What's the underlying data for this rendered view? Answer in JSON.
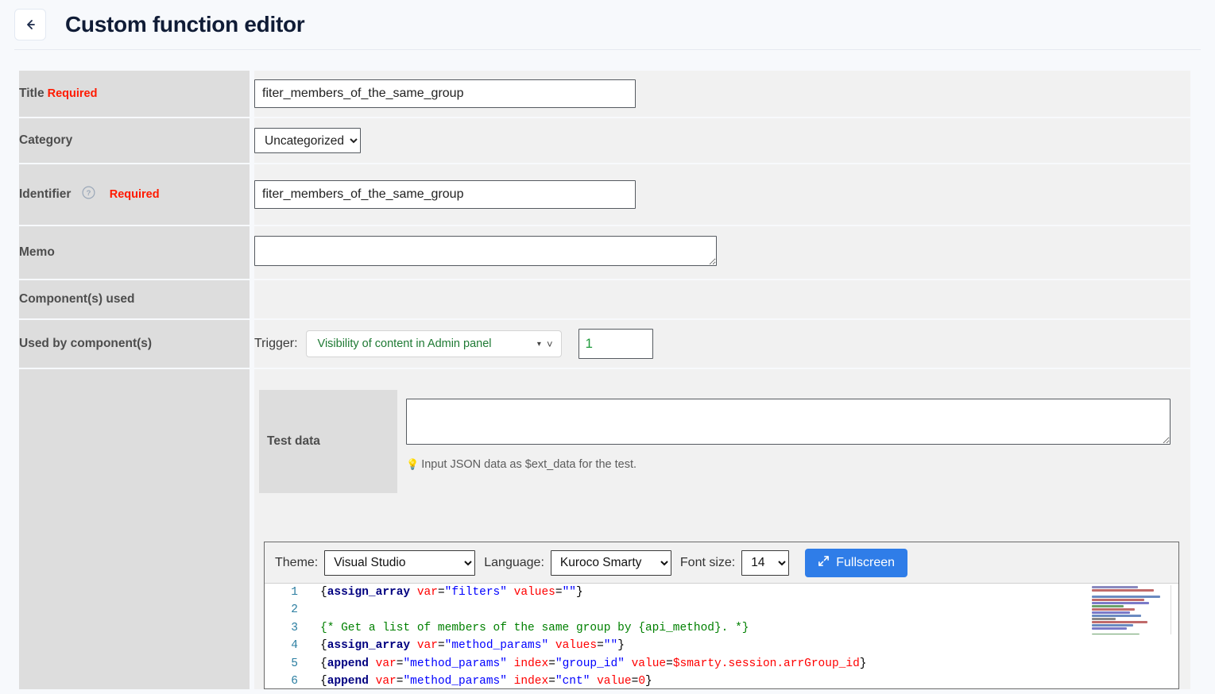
{
  "header": {
    "back_icon": "arrow-left-icon",
    "title": "Custom function editor"
  },
  "form": {
    "rows": [
      {
        "label": "Title",
        "required": "Required"
      },
      {
        "label": "Category"
      },
      {
        "label": "Identifier",
        "required": "Required",
        "help_icon": "question-circle-icon"
      },
      {
        "label": "Memo"
      },
      {
        "label": "Component(s) used"
      },
      {
        "label": "Used by component(s)"
      }
    ],
    "title_value": "fiter_members_of_the_same_group",
    "title_placeholder": "",
    "category_value": "Uncategorized",
    "category_options": [
      "Uncategorized"
    ],
    "identifier_value": "fiter_members_of_the_same_group",
    "identifier_placeholder": "",
    "memo_value": "",
    "memo_placeholder": ""
  },
  "trigger": {
    "label": "Trigger:",
    "selected": "Visibility of content in Admin panel",
    "options": [
      "Visibility of content in Admin panel"
    ],
    "caret_icon": "caret-down-icon",
    "chevron_icon": "chevron-down-icon",
    "number_value": "1"
  },
  "test_data": {
    "label": "Test data",
    "value": "",
    "placeholder": "",
    "hint_icon": "lightbulb-icon",
    "hint": "Input JSON data as $ext_data for the test."
  },
  "editor": {
    "theme_label": "Theme:",
    "theme_value": "Visual Studio",
    "theme_options": [
      "Visual Studio"
    ],
    "language_label": "Language:",
    "language_value": "Kuroco Smarty",
    "language_options": [
      "Kuroco Smarty"
    ],
    "fontsize_label": "Font size:",
    "fontsize_value": "14",
    "fontsize_options": [
      "14"
    ],
    "fullscreen_label": "Fullscreen",
    "fullscreen_icon": "expand-arrows-icon",
    "minimap_icon": "minimap",
    "lines": [
      {
        "n": "1",
        "tokens": [
          {
            "t": "{",
            "c": ""
          },
          {
            "t": "assign_array",
            "c": "k"
          },
          {
            "t": " ",
            "c": ""
          },
          {
            "t": "var",
            "c": "at"
          },
          {
            "t": "=",
            "c": ""
          },
          {
            "t": "\"filters\"",
            "c": "s"
          },
          {
            "t": " ",
            "c": ""
          },
          {
            "t": "values",
            "c": "at"
          },
          {
            "t": "=",
            "c": ""
          },
          {
            "t": "\"\"",
            "c": "s"
          },
          {
            "t": "}",
            "c": ""
          }
        ]
      },
      {
        "n": "2",
        "tokens": []
      },
      {
        "n": "3",
        "tokens": [
          {
            "t": "{* Get a list of members of the same group by {api_method}. *}",
            "c": "cm"
          }
        ]
      },
      {
        "n": "4",
        "tokens": [
          {
            "t": "{",
            "c": ""
          },
          {
            "t": "assign_array",
            "c": "k"
          },
          {
            "t": " ",
            "c": ""
          },
          {
            "t": "var",
            "c": "at"
          },
          {
            "t": "=",
            "c": ""
          },
          {
            "t": "\"method_params\"",
            "c": "s"
          },
          {
            "t": " ",
            "c": ""
          },
          {
            "t": "values",
            "c": "at"
          },
          {
            "t": "=",
            "c": ""
          },
          {
            "t": "\"\"",
            "c": "s"
          },
          {
            "t": "}",
            "c": ""
          }
        ]
      },
      {
        "n": "5",
        "tokens": [
          {
            "t": "{",
            "c": ""
          },
          {
            "t": "append",
            "c": "k"
          },
          {
            "t": " ",
            "c": ""
          },
          {
            "t": "var",
            "c": "at"
          },
          {
            "t": "=",
            "c": ""
          },
          {
            "t": "\"method_params\"",
            "c": "s"
          },
          {
            "t": " ",
            "c": ""
          },
          {
            "t": "index",
            "c": "at"
          },
          {
            "t": "=",
            "c": ""
          },
          {
            "t": "\"group_id\"",
            "c": "s"
          },
          {
            "t": " ",
            "c": ""
          },
          {
            "t": "value",
            "c": "at"
          },
          {
            "t": "=",
            "c": ""
          },
          {
            "t": "$smarty.session.arrGroup_id",
            "c": "vr"
          },
          {
            "t": "}",
            "c": ""
          }
        ]
      },
      {
        "n": "6",
        "tokens": [
          {
            "t": "{",
            "c": ""
          },
          {
            "t": "append",
            "c": "k"
          },
          {
            "t": " ",
            "c": ""
          },
          {
            "t": "var",
            "c": "at"
          },
          {
            "t": "=",
            "c": ""
          },
          {
            "t": "\"method_params\"",
            "c": "s"
          },
          {
            "t": " ",
            "c": ""
          },
          {
            "t": "index",
            "c": "at"
          },
          {
            "t": "=",
            "c": ""
          },
          {
            "t": "\"cnt\"",
            "c": "s"
          },
          {
            "t": " ",
            "c": ""
          },
          {
            "t": "value",
            "c": "at"
          },
          {
            "t": "=",
            "c": ""
          },
          {
            "t": "0",
            "c": "vr"
          },
          {
            "t": "}",
            "c": ""
          }
        ]
      }
    ]
  },
  "colors": {
    "page_bg": "#f7f9fc",
    "label_bg": "#dddddd",
    "value_bg": "#f1f1f1",
    "required_red": "#ff1a00",
    "trigger_green": "#1f7a34",
    "accent_blue": "#2f7de8",
    "title_navy": "#101c36",
    "hint_orange": "#ee7a2e"
  }
}
